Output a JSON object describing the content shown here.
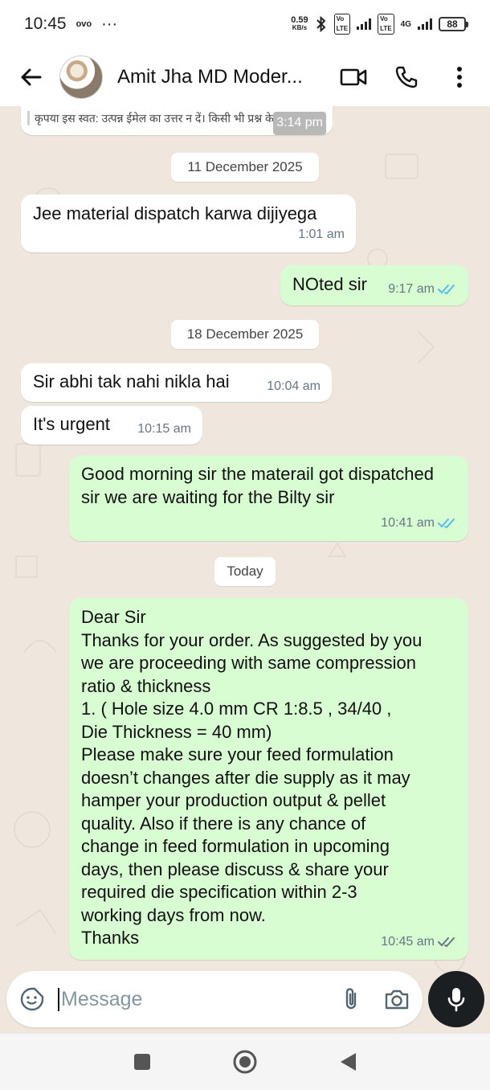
{
  "status_bar": {
    "time": "10:45",
    "carrier": "ovo",
    "more": "···",
    "speed_value": "0.59",
    "speed_unit": "KB/s",
    "network": "4G",
    "battery": "88"
  },
  "header": {
    "contact_name": "Amit Jha MD Moder..."
  },
  "messages": [
    {
      "type": "in",
      "text": "कृपया इस स्वत: उत्पन्न ईमेल का उत्तर न दें। किसी भी प्रश्न के",
      "time": "3:14 pm"
    },
    {
      "type": "date",
      "text": "11 December 2025"
    },
    {
      "type": "in",
      "text": "Jee material dispatch karwa dijiyega",
      "time": "1:01 am"
    },
    {
      "type": "out",
      "text": "NOted sir",
      "time": "9:17 am",
      "status": "read"
    },
    {
      "type": "date",
      "text": "18 December 2025"
    },
    {
      "type": "in",
      "text": "Sir abhi tak nahi nikla hai",
      "time": "10:04 am"
    },
    {
      "type": "in",
      "text": "It's urgent",
      "time": "10:15 am"
    },
    {
      "type": "out",
      "text": "Good morning sir the materail got dispatched sir we are waiting for the Bilty sir",
      "time": "10:41 am",
      "status": "read"
    },
    {
      "type": "date",
      "text": "Today"
    },
    {
      "type": "out",
      "lines": [
        "Dear Sir",
        "Thanks for your order. As suggested by you",
        "we are proceeding with same compression",
        "ratio & thickness",
        "1.  ( Hole size 4.0 mm CR 1:8.5  , 34/40  ,",
        "Die Thickness = 40 mm)",
        "Please make sure your feed formulation",
        "doesn’t changes after die supply as it may",
        "hamper your production output & pellet",
        "quality. Also if there is any chance of",
        "change in feed formulation in upcoming",
        "days, then please discuss & share your",
        "required die specification within 2-3",
        "working days from now.",
        "Thanks"
      ],
      "time": "10:45 am",
      "status": "delivered"
    }
  ],
  "input": {
    "placeholder": "Message"
  },
  "colors": {
    "incoming_bubble": "#ffffff",
    "outgoing_bubble": "#d9fdd3",
    "chat_background": "#efe7dd",
    "read_tick": "#53bdeb",
    "delivered_tick": "#667781"
  }
}
